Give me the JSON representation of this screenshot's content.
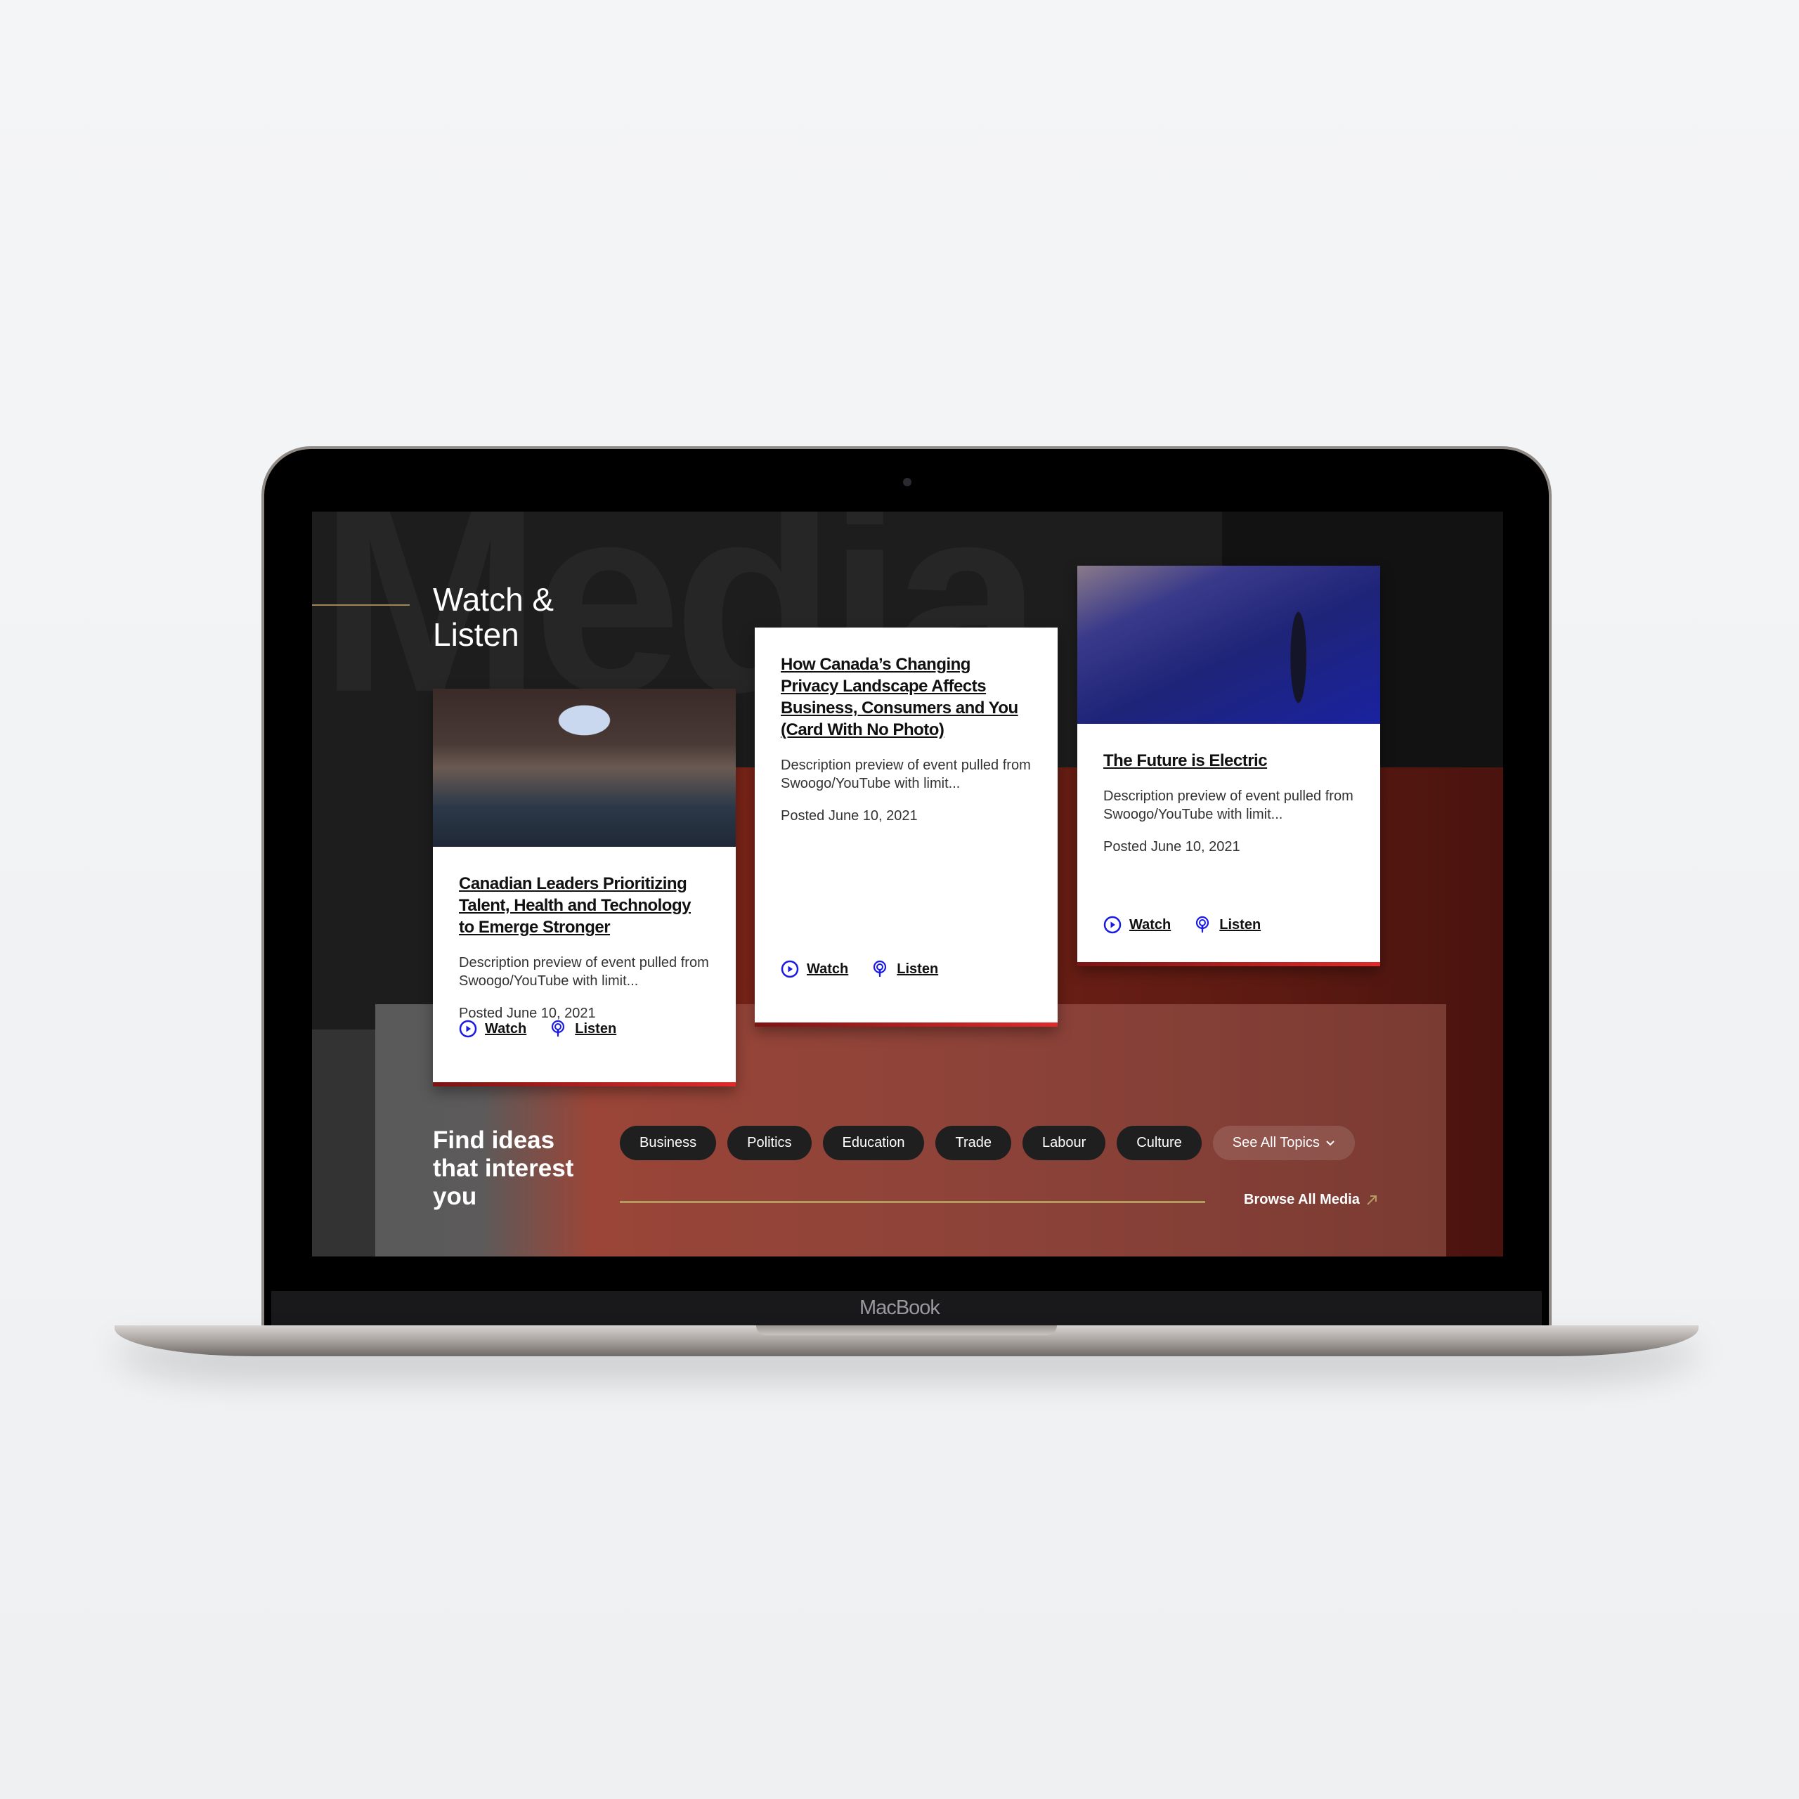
{
  "device": {
    "brand": "MacBook"
  },
  "section": {
    "background_word": "Media",
    "title": "Watch & Listen"
  },
  "cards": [
    {
      "title": "Canadian Leaders Prioritizing Talent, Health and Technology to Emerge Stronger",
      "description": "Description preview of event pulled from Swoogo/YouTube with limit...",
      "date": "Posted June 10, 2021",
      "watch": "Watch",
      "listen": "Listen",
      "has_photo": true
    },
    {
      "title": "How Canada’s Changing Privacy Landscape Affects Business, Consumers and You (Card With No Photo)",
      "description": "Description preview of event pulled from Swoogo/YouTube with limit...",
      "date": "Posted June 10, 2021",
      "watch": "Watch",
      "listen": "Listen",
      "has_photo": false
    },
    {
      "title": "The Future is Electric",
      "description": "Description preview of event pulled from Swoogo/YouTube with limit...",
      "date": "Posted June 10, 2021",
      "watch": "Watch",
      "listen": "Listen",
      "has_photo": true
    }
  ],
  "topics": {
    "heading": "Find ideas that interest you",
    "items": [
      "Business",
      "Politics",
      "Education",
      "Trade",
      "Labour",
      "Culture"
    ],
    "see_all": "See All Topics",
    "browse": "Browse All Media"
  },
  "colors": {
    "accent_blue": "#1a1ae6",
    "accent_red": "#e02a2a",
    "gold": "#b59a60"
  }
}
